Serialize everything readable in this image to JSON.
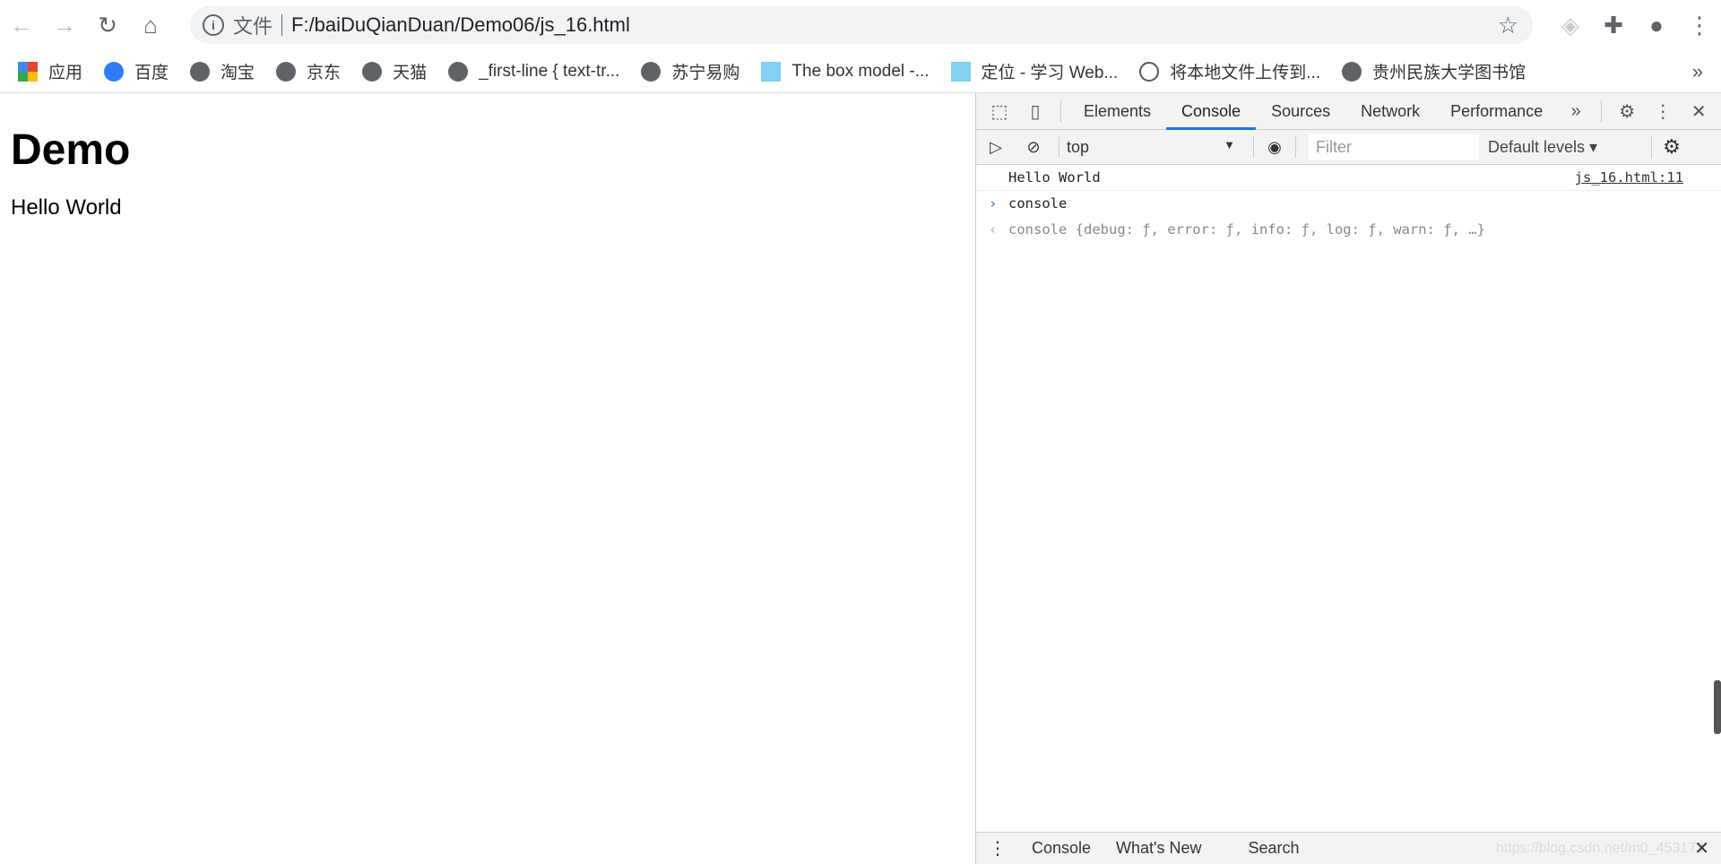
{
  "browser": {
    "address": {
      "scheme_label": "文件",
      "url": "F:/baiDuQianDuan/Demo06/js_16.html"
    },
    "bookmarks": [
      {
        "label": "应用",
        "icon": "apps-icon"
      },
      {
        "label": "百度",
        "icon": "baidu-icon"
      },
      {
        "label": "淘宝",
        "icon": "globe-icon"
      },
      {
        "label": "京东",
        "icon": "globe-icon"
      },
      {
        "label": "天猫",
        "icon": "globe-icon"
      },
      {
        "label": "_first-line {  text-tr...",
        "icon": "globe-icon"
      },
      {
        "label": "苏宁易购",
        "icon": "globe-icon"
      },
      {
        "label": "The box model -...",
        "icon": "mdn-icon"
      },
      {
        "label": "定位 - 学习 Web...",
        "icon": "mdn-icon"
      },
      {
        "label": "将本地文件上传到...",
        "icon": "upload-icon"
      },
      {
        "label": "贵州民族大学图书馆",
        "icon": "globe-icon"
      }
    ],
    "more_label": "»"
  },
  "page": {
    "heading": "Demo",
    "text": "Hello World"
  },
  "devtools": {
    "tabs": [
      "Elements",
      "Console",
      "Sources",
      "Network",
      "Performance"
    ],
    "active_tab": "Console",
    "context": "top",
    "filter_placeholder": "Filter",
    "levels": "Default levels ▾",
    "messages": [
      {
        "text": "Hello World",
        "source": "js_16.html:11"
      },
      {
        "text": "console",
        "prompt": "›"
      },
      {
        "text": "console {debug: ƒ, error: ƒ, info: ƒ, log: ƒ, warn: ƒ, …}",
        "prompt": "‹"
      }
    ],
    "drawer_tabs": [
      "Console",
      "What's New",
      "Search"
    ],
    "watermark": "https://blog.csdn.net/m0_453173"
  }
}
